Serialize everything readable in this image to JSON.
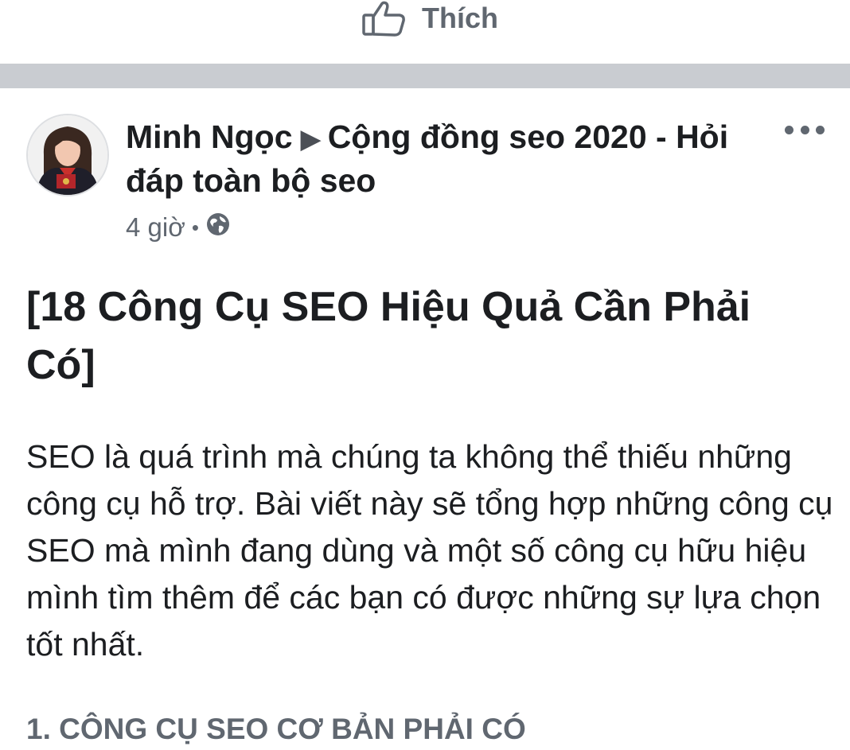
{
  "like_bar": {
    "like_label": "Thích",
    "like_icon": "thumbs-up-outline-icon"
  },
  "post": {
    "author": "Minh Ngọc",
    "separator_icon": "▶",
    "group": "Cộng đồng seo 2020 - Hỏi đáp toàn bộ seo",
    "time": "4 giờ",
    "meta_dot": "•",
    "privacy_icon": "globe-icon",
    "more_icon": "more-horizontal-icon",
    "title": "[18 Công Cụ SEO Hiệu Quả Cần Phải Có]",
    "body": "SEO là quá trình mà chúng ta không thể thiếu những công cụ hỗ trợ. Bài viết này sẽ tổng hợp những công cụ SEO mà mình đang dùng và một số công cụ hữu hiệu mình tìm thêm để các bạn có được những sự lựa chọn tốt nhất.",
    "section_heading": "1. CÔNG CỤ SEO CƠ BẢN PHẢI CÓ"
  },
  "colors": {
    "separator": "#c9ccd1",
    "text_primary": "#1c1e21",
    "text_secondary": "#606770"
  }
}
